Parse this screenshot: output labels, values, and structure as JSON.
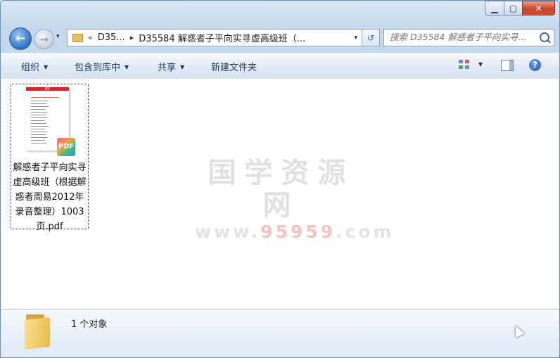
{
  "window": {
    "buttons": {
      "minimize_glyph": "▁",
      "maximize_glyph": "▢",
      "close_glyph": "✕"
    }
  },
  "nav": {
    "back_glyph": "←",
    "forward_glyph": "→",
    "history_dropdown_glyph": "▾",
    "address": {
      "overflow_glyph": "«",
      "crumbs": [
        "D35...",
        "D35584 解惑者子平向实寻虚高级班（..."
      ],
      "separator": "▸",
      "dropdown_glyph": "▾"
    },
    "refresh_glyph": "↺",
    "search_placeholder": "搜索 D35584 解惑者子平向实寻..."
  },
  "toolbar": {
    "organize": "组织",
    "include_in_library": "包含到库中",
    "share": "共享",
    "new_folder": "新建文件夹",
    "help_glyph": "?"
  },
  "files": [
    {
      "name": "解惑者子平向实寻虚高级班（根据解惑者周易2012年录音整理）1003页.pdf",
      "badge": "PDF",
      "thumb_header": "PDF"
    }
  ],
  "watermark": {
    "title": "国学资源网",
    "url_prefix": "www.",
    "url_highlight": "95959",
    "url_suffix": ".com"
  },
  "status": {
    "count_text": "1 个对象"
  },
  "colors": {
    "accent": "#1e395b",
    "close_red": "#c9462c",
    "pdf_red": "#d3242d"
  }
}
